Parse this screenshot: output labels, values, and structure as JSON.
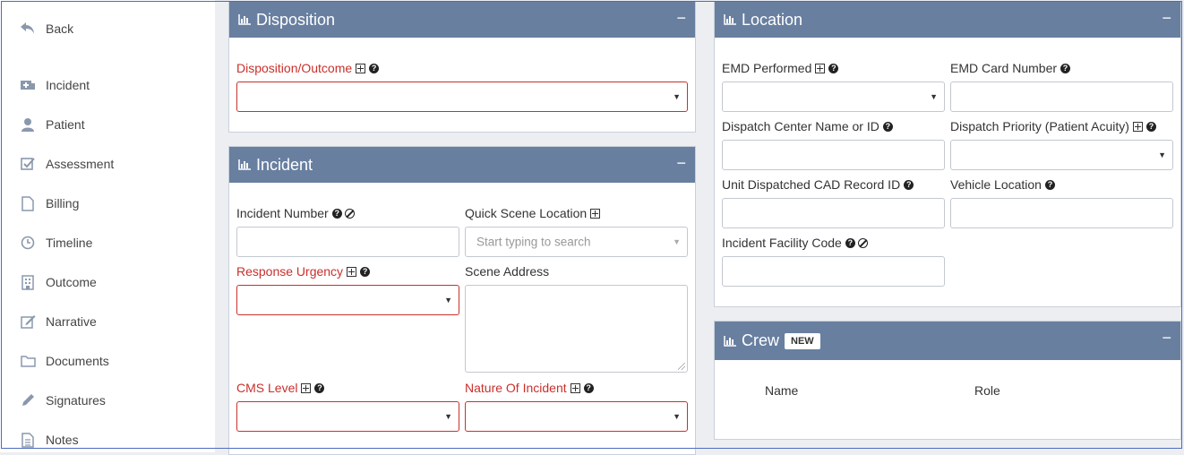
{
  "sidebar": {
    "back": "Back",
    "items": [
      {
        "label": "Incident",
        "icon": "ambulance-icon"
      },
      {
        "label": "Patient",
        "icon": "user-icon"
      },
      {
        "label": "Assessment",
        "icon": "checkbox-icon"
      },
      {
        "label": "Billing",
        "icon": "file-icon"
      },
      {
        "label": "Timeline",
        "icon": "clock-icon"
      },
      {
        "label": "Outcome",
        "icon": "building-icon"
      },
      {
        "label": "Narrative",
        "icon": "edit-icon"
      },
      {
        "label": "Documents",
        "icon": "folder-icon"
      },
      {
        "label": "Signatures",
        "icon": "pencil-icon"
      },
      {
        "label": "Notes",
        "icon": "note-icon"
      }
    ]
  },
  "disposition": {
    "title": "Disposition",
    "collapse": "−",
    "outcome_label": "Disposition/Outcome"
  },
  "incident": {
    "title": "Incident",
    "collapse": "−",
    "incident_number_label": "Incident Number",
    "quick_scene_label": "Quick Scene Location",
    "quick_scene_placeholder": "Start typing to search",
    "response_urgency_label": "Response Urgency",
    "scene_address_label": "Scene Address",
    "cms_level_label": "CMS Level",
    "nature_label": "Nature Of Incident"
  },
  "location": {
    "title": "Location",
    "collapse": "−",
    "emd_performed_label": "EMD Performed",
    "emd_card_label": "EMD Card Number",
    "dispatch_center_label": "Dispatch Center Name or ID",
    "dispatch_priority_label": "Dispatch Priority (Patient Acuity)",
    "cad_record_label": "Unit Dispatched CAD Record ID",
    "vehicle_location_label": "Vehicle Location",
    "facility_code_label": "Incident Facility Code"
  },
  "crew": {
    "title": "Crew",
    "badge": "NEW",
    "collapse": "−",
    "columns": [
      "Name",
      "Role"
    ]
  },
  "colors": {
    "header": "#687fa0",
    "required": "#c9302c"
  }
}
